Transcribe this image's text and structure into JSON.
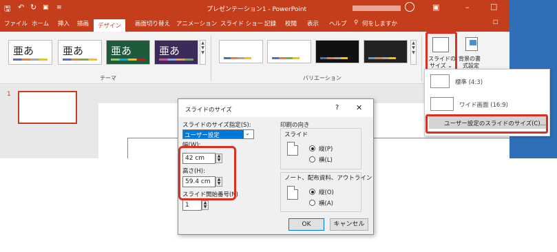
{
  "titlebar": {
    "title": "プレゼンテーション1 - PowerPoint",
    "quick_access": [
      "save",
      "undo",
      "redo",
      "start-from-beginning"
    ]
  },
  "tabs": [
    {
      "label": "ファイル"
    },
    {
      "label": "ホーム"
    },
    {
      "label": "挿入"
    },
    {
      "label": "描画"
    },
    {
      "label": "デザイン",
      "active": true
    },
    {
      "label": "画面切り替え"
    },
    {
      "label": "アニメーション"
    },
    {
      "label": "スライド ショー"
    },
    {
      "label": "記録"
    },
    {
      "label": "校閲"
    },
    {
      "label": "表示"
    },
    {
      "label": "ヘルプ"
    },
    {
      "label": "何をしますか"
    }
  ],
  "ribbon": {
    "themes_label": "テーマ",
    "variations_label": "バリエーション",
    "theme_glyph": "亜あ",
    "slide_size_label_1": "スライドの",
    "slide_size_label_2": "サイズ ⌄",
    "bg_format_label_1": "背景の書",
    "bg_format_label_2": "式設定"
  },
  "slide_pane": {
    "slide_number": "1"
  },
  "dropdown": {
    "items": [
      {
        "label": "標準 (4:3)"
      },
      {
        "label": "ワイド画面 (16:9)"
      },
      {
        "label": "ユーザー設定のスライドのサイズ(C)..."
      }
    ]
  },
  "dialog": {
    "title": "スライドのサイズ",
    "help": "?",
    "close": "✕",
    "size_for_label": "スライドのサイズ指定(S):",
    "size_for_value": "ユーザー設定",
    "width_label": "幅(W):",
    "width_value": "42 cm",
    "height_label": "高さ(H):",
    "height_value": "59.4 cm",
    "number_from_label": "スライド開始番号(N)",
    "number_from_value": "1",
    "orientation_label": "印刷の向き",
    "slides_label": "スライド",
    "portrait_label": "縦(P)",
    "landscape_label": "横(L)",
    "notes_label": "ノート、配布資料、アウトライン",
    "notes_portrait_label": "縦(O)",
    "notes_landscape_label": "横(A)",
    "ok_label": "OK",
    "cancel_label": "キャンセル"
  },
  "colors": {
    "accent": "#c43e1c",
    "highlight": "#d92f24"
  }
}
